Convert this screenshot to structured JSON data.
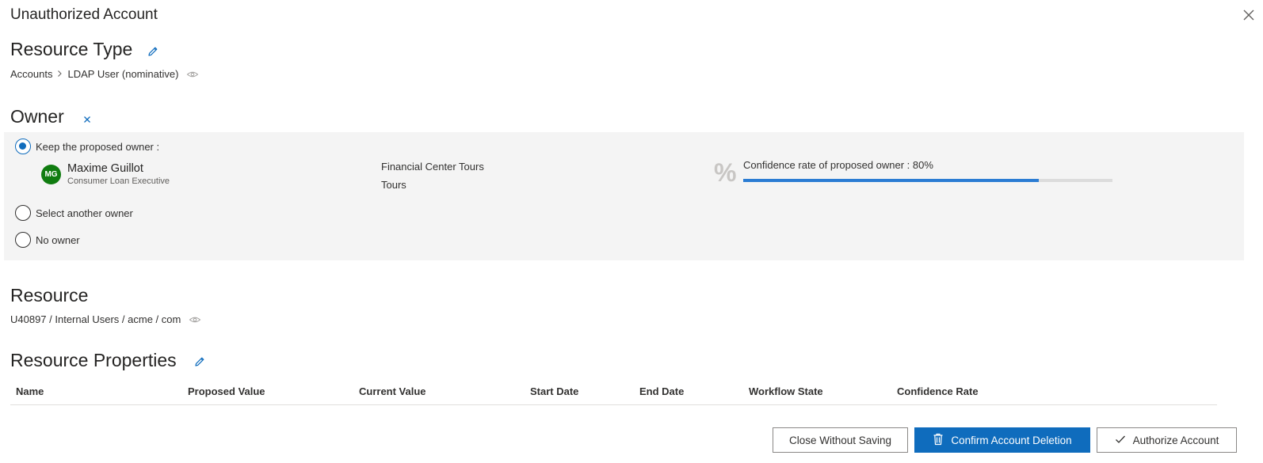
{
  "dialog": {
    "title": "Unauthorized Account",
    "close_icon": "close-icon"
  },
  "resource_type": {
    "heading": "Resource Type",
    "edit_icon": "pencil-icon",
    "breadcrumb": [
      "Accounts",
      "LDAP User (nominative)"
    ],
    "separator_icon": "chevron-right-icon",
    "view_icon": "eye-icon"
  },
  "owner": {
    "heading": "Owner",
    "clear_icon": "close-icon",
    "options": [
      {
        "label": "Keep the proposed owner :",
        "selected": true
      },
      {
        "label": "Select another owner",
        "selected": false
      },
      {
        "label": "No owner",
        "selected": false
      }
    ],
    "proposed": {
      "initials": "MG",
      "name": "Maxime Guillot",
      "job_title": "Consumer Loan Executive",
      "organization": "Financial Center Tours",
      "location": "Tours",
      "confidence_icon": "percent-icon",
      "confidence_label": "Confidence rate of proposed owner : 80%",
      "confidence_value": 0.8
    }
  },
  "resource": {
    "heading": "Resource",
    "path": "U40897 / Internal Users / acme / com",
    "view_icon": "eye-icon"
  },
  "resource_properties": {
    "heading": "Resource Properties",
    "edit_icon": "pencil-icon",
    "columns": [
      "Name",
      "Proposed Value",
      "Current Value",
      "Start Date",
      "End Date",
      "Workflow State",
      "Confidence Rate"
    ]
  },
  "footer": {
    "close_label": "Close Without Saving",
    "delete_label": "Confirm Account Deletion",
    "delete_icon": "trash-icon",
    "authorize_label": "Authorize Account",
    "authorize_icon": "checkmark-icon"
  },
  "colors": {
    "accent": "#0f6cbd",
    "avatar": "#107c10",
    "progress": "#2b7cd3",
    "panel": "#f4f4f4"
  }
}
